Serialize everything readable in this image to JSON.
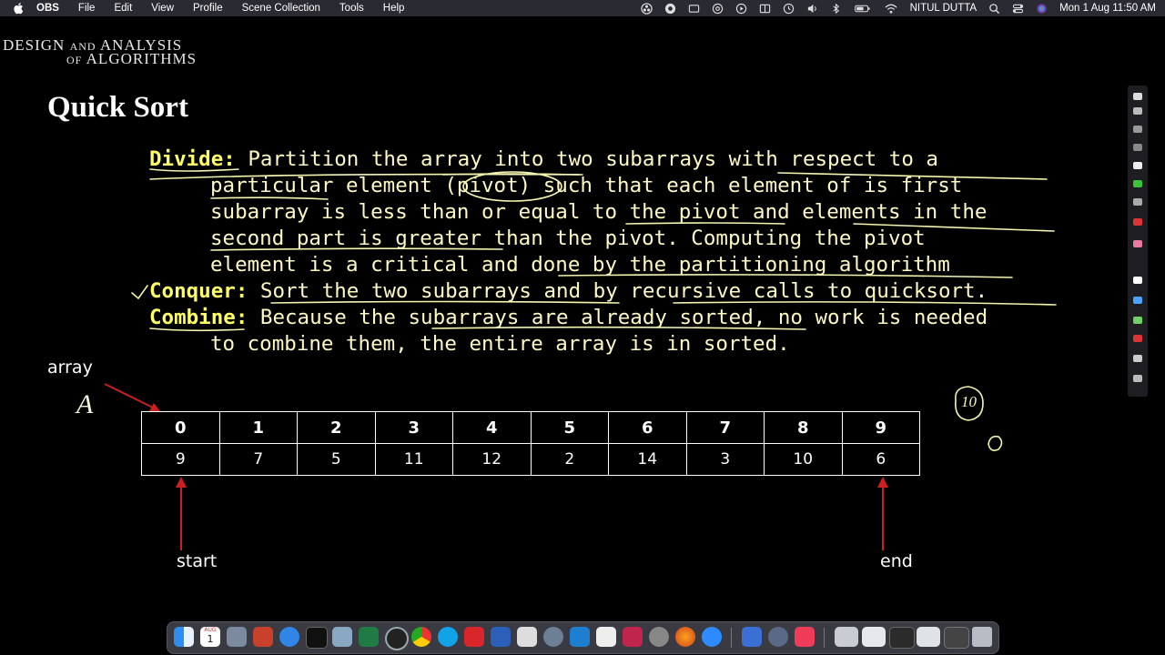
{
  "menubar": {
    "app_name": "OBS",
    "items": [
      "File",
      "Edit",
      "View",
      "Profile",
      "Scene Collection",
      "Tools",
      "Help"
    ],
    "user_name": "NITUL DUTTA",
    "datetime": "Mon 1 Aug  11:50 AM"
  },
  "slide": {
    "course_logo": {
      "line1_a": "DESIGN",
      "line1_b": "AND",
      "line1_c": "ANALYSIS",
      "line2_a": "OF",
      "line2_b": "ALGORITHMS"
    },
    "title": "Quick Sort",
    "divide": {
      "term": "Divide:",
      "lines": [
        " Partition the array into two subarrays with respect to a",
        "particular element (pivot) such that each element of is first",
        "subarray is less than or equal to the pivot and elements in the",
        "second part is greater than the pivot. Computing the pivot",
        "element is a critical and done by the partitioning algorithm"
      ]
    },
    "conquer": {
      "term": "Conquer:",
      "text": " Sort the two subarrays and by recursive calls to quicksort."
    },
    "combine": {
      "term": "Combine:",
      "lines": [
        " Because the subarrays are already sorted, no work is needed",
        "to combine them, the entire array is in sorted."
      ]
    },
    "array_label": "array",
    "array_name": "A",
    "indices": [
      "0",
      "1",
      "2",
      "3",
      "4",
      "5",
      "6",
      "7",
      "8",
      "9"
    ],
    "values": [
      "9",
      "7",
      "5",
      "11",
      "12",
      "2",
      "14",
      "3",
      "10",
      "6"
    ],
    "start_label": "start",
    "end_label": "end",
    "handwritten_note": "10"
  },
  "colors": {
    "slide_bg": "#000000",
    "body_text": "#fff9c4",
    "term_text": "#ffff66",
    "ink": "#f5f5b0",
    "arrow": "#cc1f1f",
    "menubar": "#2a2a33"
  },
  "dock": {
    "apps": [
      "finder",
      "calendar",
      "launchpad",
      "powerpoint",
      "safari",
      "terminal",
      "preview",
      "excel",
      "screen-recorder",
      "chrome",
      "skype",
      "pdf-reader",
      "word",
      "keynote",
      "network-utility",
      "vscode",
      "notes",
      "mindmap",
      "system-preferences",
      "firefox",
      "zoom",
      "keynote-2",
      "quicktime",
      "music",
      "window-1",
      "window-2",
      "window-3",
      "window-4",
      "window-5",
      "trash"
    ],
    "calendar_month": "AUG",
    "calendar_day": "1"
  }
}
